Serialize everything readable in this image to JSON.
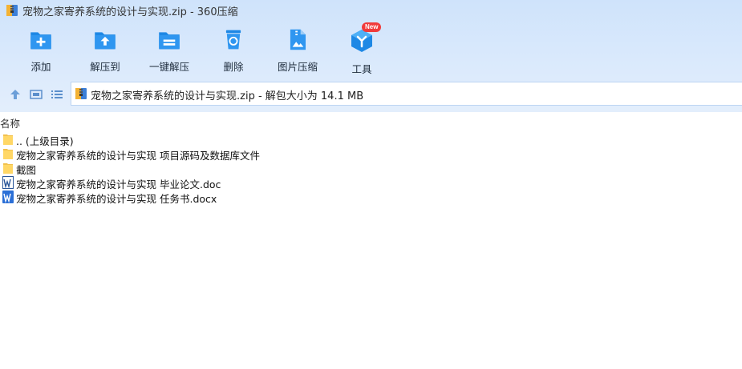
{
  "window": {
    "title": "宠物之家寄养系统的设计与实现.zip - 360压缩"
  },
  "toolbar": {
    "items": [
      {
        "label": "添加",
        "icon": "add-folder-icon"
      },
      {
        "label": "解压到",
        "icon": "extract-to-icon"
      },
      {
        "label": "一键解压",
        "icon": "one-click-extract-icon"
      },
      {
        "label": "删除",
        "icon": "recycle-delete-icon"
      },
      {
        "label": "图片压缩",
        "icon": "image-compress-icon"
      },
      {
        "label": "工具",
        "icon": "tools-cube-icon",
        "badge": "New"
      }
    ]
  },
  "nav": {
    "path": "宠物之家寄养系统的设计与实现.zip - 解包大小为 14.1 MB"
  },
  "columns": {
    "name": "名称"
  },
  "files": [
    {
      "name": ".. (上级目录)",
      "type": "folder"
    },
    {
      "name": "宠物之家寄养系统的设计与实现 项目源码及数据库文件",
      "type": "folder"
    },
    {
      "name": "截图",
      "type": "folder"
    },
    {
      "name": "宠物之家寄养系统的设计与实现 毕业论文.doc",
      "type": "doc"
    },
    {
      "name": "宠物之家寄养系统的设计与实现 任务书.docx",
      "type": "docx"
    }
  ],
  "colors": {
    "accent": "#1e88e5",
    "header_bg": "#d6e7fb",
    "folder": "#ffd766",
    "badge": "#f13b3b"
  }
}
